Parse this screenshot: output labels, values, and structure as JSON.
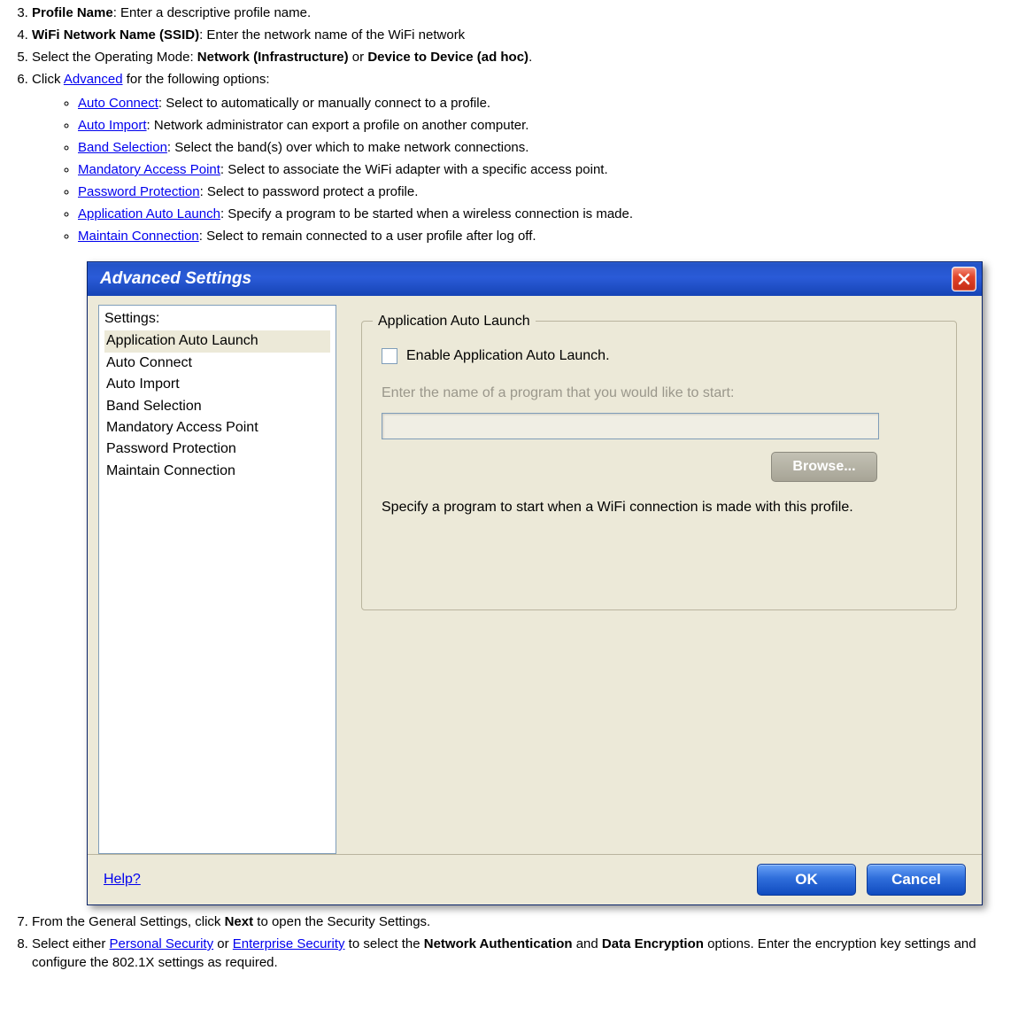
{
  "list": {
    "item3": {
      "bold": "Profile Name",
      "rest": ": Enter a descriptive profile name."
    },
    "item4": {
      "bold": "WiFi Network Name (SSID)",
      "rest": ": Enter the network name of the WiFi network"
    },
    "item5": {
      "pre": "Select the Operating Mode: ",
      "b1": "Network (Infrastructure)",
      "mid": " or ",
      "b2": "Device to Device (ad hoc)",
      "post": "."
    },
    "item6": {
      "pre": "Click ",
      "link": "Advanced",
      "post": " for the following options:"
    },
    "item7": {
      "pre": "From the General Settings, click ",
      "bold": "Next",
      "post": " to open the Security Settings."
    },
    "item8": {
      "pre": "Select either ",
      "link1": "Personal Security",
      "mid1": " or ",
      "link2": "Enterprise Security",
      "mid2": " to select the ",
      "b1": "Network Authentication",
      "mid3": " and ",
      "b2": "Data Encryption",
      "post": " options. Enter the encryption key settings and configure the 802.1X settings as required."
    }
  },
  "sub": [
    {
      "link": "Auto Connect",
      "rest": ": Select to automatically or manually connect to a profile."
    },
    {
      "link": "Auto Import",
      "rest": ": Network administrator can export a profile on another computer."
    },
    {
      "link": "Band Selection",
      "rest": ": Select the band(s) over which to make network connections."
    },
    {
      "link": "Mandatory Access Point",
      "rest": ": Select to associate the WiFi adapter with a specific access point."
    },
    {
      "link": "Password Protection",
      "rest": ": Select to password protect a profile."
    },
    {
      "link": "Application Auto Launch",
      "rest": ": Specify a program to be started when a wireless connection is made."
    },
    {
      "link": "Maintain Connection",
      "rest": ": Select to remain connected to a user profile after log off."
    }
  ],
  "window": {
    "title": "Advanced Settings",
    "left": {
      "label": "Settings:",
      "items": [
        "Application Auto Launch",
        "Auto Connect",
        "Auto Import",
        "Band Selection",
        "Mandatory Access Point",
        "Password Protection",
        "Maintain Connection"
      ],
      "selectedIndex": 0
    },
    "group": {
      "legend": "Application Auto Launch",
      "checkboxLabel": "Enable Application Auto Launch.",
      "hint": "Enter the name of a program that you would like to start:",
      "browse": "Browse...",
      "desc": "Specify a program to start when a WiFi connection is made with this profile."
    },
    "footer": {
      "help": "Help?",
      "ok": "OK",
      "cancel": "Cancel"
    }
  }
}
